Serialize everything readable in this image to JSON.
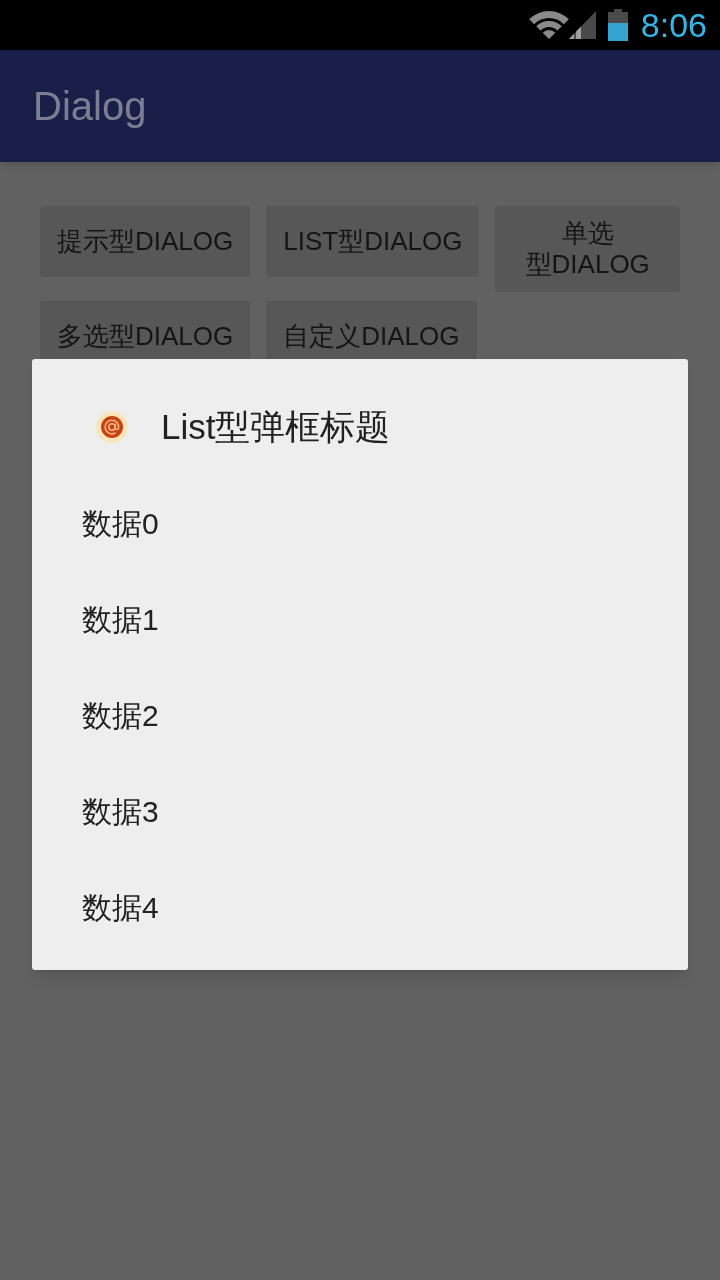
{
  "status_bar": {
    "time": "8:06"
  },
  "app_bar": {
    "title": "Dialog"
  },
  "button_rows": [
    [
      {
        "label": "提示型DIALOG"
      },
      {
        "label": "LIST型DIALOG"
      },
      {
        "label": "单选型DIALOG"
      }
    ],
    [
      {
        "label": "多选型DIALOG"
      },
      {
        "label": "自定义DIALOG"
      }
    ]
  ],
  "dialog": {
    "title": "List型弹框标题",
    "items": [
      {
        "label": "数据0"
      },
      {
        "label": "数据1"
      },
      {
        "label": "数据2"
      },
      {
        "label": "数据3"
      },
      {
        "label": "数据4"
      }
    ]
  }
}
